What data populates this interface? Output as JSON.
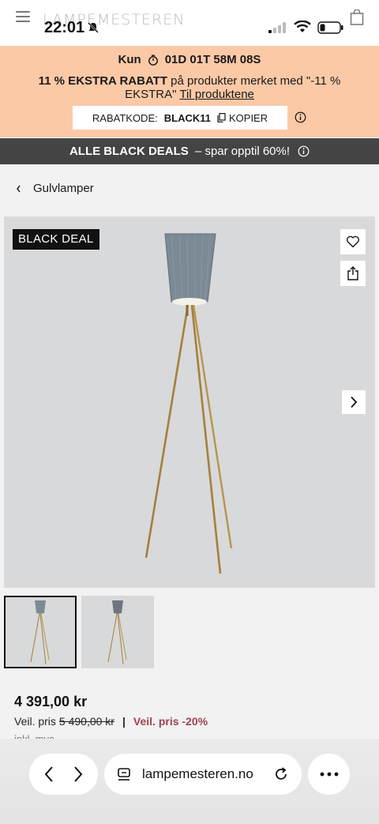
{
  "status_bar": {
    "time": "22:01"
  },
  "site": {
    "logo": "LAMPEMESTEREN"
  },
  "promo": {
    "countdown_prefix": "Kun",
    "countdown": "01D 01T 58M 08S",
    "headline_bold": "11 % EKSTRA RABATT",
    "headline_rest": " på produkter merket med \"-11 % EKSTRA\" ",
    "link": "Til produktene",
    "code_label": "RABATKODE:",
    "code_value": "BLACK11",
    "copy_label": "KOPIER"
  },
  "deals_bar": {
    "bold": "ALLE BLACK DEALS",
    "rest": " – spar opptil 60%!"
  },
  "breadcrumb": {
    "label": "Gulvlamper"
  },
  "gallery": {
    "badge": "BLACK DEAL"
  },
  "product": {
    "price": "4 391,00 kr",
    "veil_label": "Veil. pris",
    "veil_old": "5 490,00 kr",
    "veil_separator": "|",
    "veil_discount": "Veil. pris -20%",
    "vat_note": "inkl. mva"
  },
  "browser": {
    "url": "lampemesteren.no"
  },
  "colors": {
    "promo_bg": "#fcc9a7",
    "deals_bg": "#444444",
    "discount": "#a0424f"
  }
}
